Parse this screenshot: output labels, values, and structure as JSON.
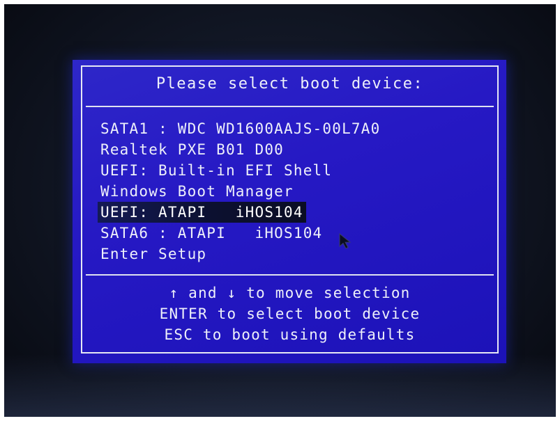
{
  "boot_menu": {
    "title": "Please select boot device:",
    "devices": [
      {
        "label": "SATA1 : WDC WD1600AAJS-00L7A0",
        "selected": false
      },
      {
        "label": "Realtek PXE B01 D00",
        "selected": false
      },
      {
        "label": "UEFI: Built-in EFI Shell",
        "selected": false
      },
      {
        "label": "Windows Boot Manager",
        "selected": false
      },
      {
        "label": "UEFI: ATAPI   iHOS104",
        "selected": true
      },
      {
        "label": "SATA6 : ATAPI   iHOS104",
        "selected": false
      },
      {
        "label": "Enter Setup",
        "selected": false
      }
    ],
    "help": [
      "↑ and ↓ to move selection",
      "ENTER to select boot device",
      "ESC to boot using defaults"
    ]
  },
  "colors": {
    "menu_background": "#2619c4",
    "text": "#eef0fa",
    "selection_highlight": "#0c1030"
  },
  "icons": {
    "cursor": "mouse-pointer-icon"
  }
}
